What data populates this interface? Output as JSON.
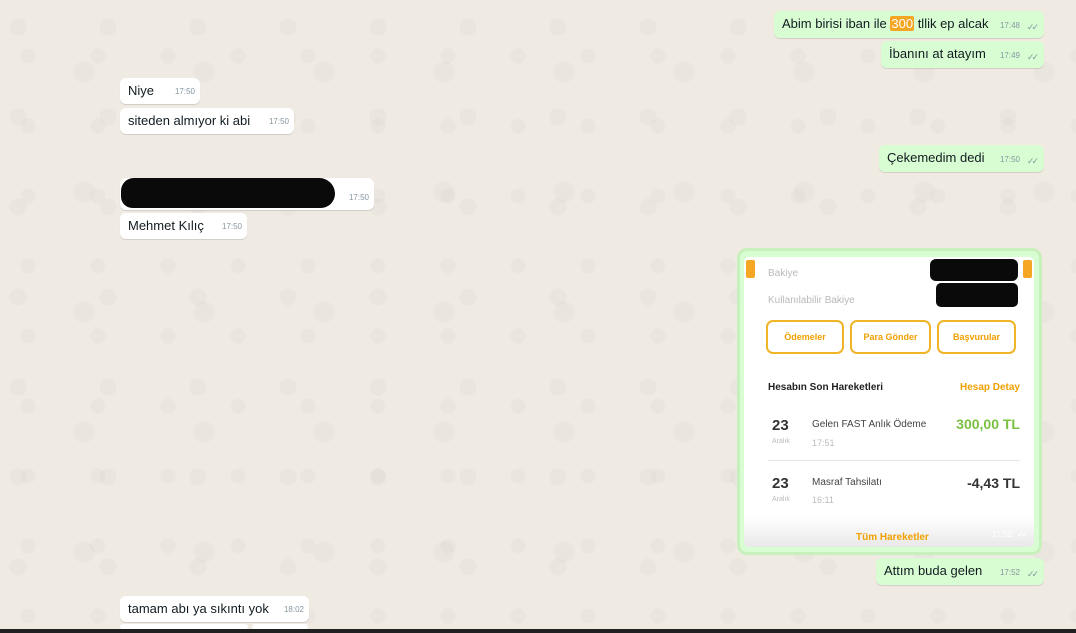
{
  "messages": {
    "m1": {
      "text_before": "Abim birisi iban ile ",
      "highlight": "300",
      "text_after": " tllik ep alcak",
      "time": "17:48"
    },
    "m2": {
      "text": "İbanını at atayım",
      "time": "17:49"
    },
    "m3": {
      "text": "Niye",
      "time": "17:50"
    },
    "m4": {
      "text": "siteden almıyor ki abi",
      "time": "17:50"
    },
    "m5": {
      "text": "Çekemedim dedi",
      "time": "17:50"
    },
    "m6": {
      "time": "17:50"
    },
    "m7": {
      "text": "Mehmet Kılıç",
      "time": "17:50"
    },
    "m8": {
      "text": "Attım buda gelen",
      "time": "17:52"
    },
    "m9": {
      "text": "tamam abı ya sıkıntı yok",
      "time": "18:02"
    }
  },
  "ticks": "✓✓",
  "bank": {
    "balance_label": "Bakiye",
    "available_label": "Kullanılabilir Bakiye",
    "buttons": [
      "Ödemeler",
      "Para Gönder",
      "Başvurular"
    ],
    "section_title": "Hesabın Son Hareketleri",
    "section_link": "Hesap Detay",
    "transactions": [
      {
        "day": "23",
        "month": "Aralık",
        "desc": "Gelen FAST Anlık Ödeme",
        "time": "17:51",
        "amount": "300,00 TL"
      },
      {
        "day": "23",
        "month": "Aralık",
        "desc": "Masraf Tahsilatı",
        "time": "16:11",
        "amount": "-4,43 TL"
      }
    ],
    "footer_link": "Tüm Hareketler",
    "image_time": "17:52"
  },
  "colors": {
    "outgoing_bubble": "#d9fdd3",
    "incoming_bubble": "#ffffff",
    "accent_orange": "#f5a623",
    "positive_green": "#7ac142"
  }
}
